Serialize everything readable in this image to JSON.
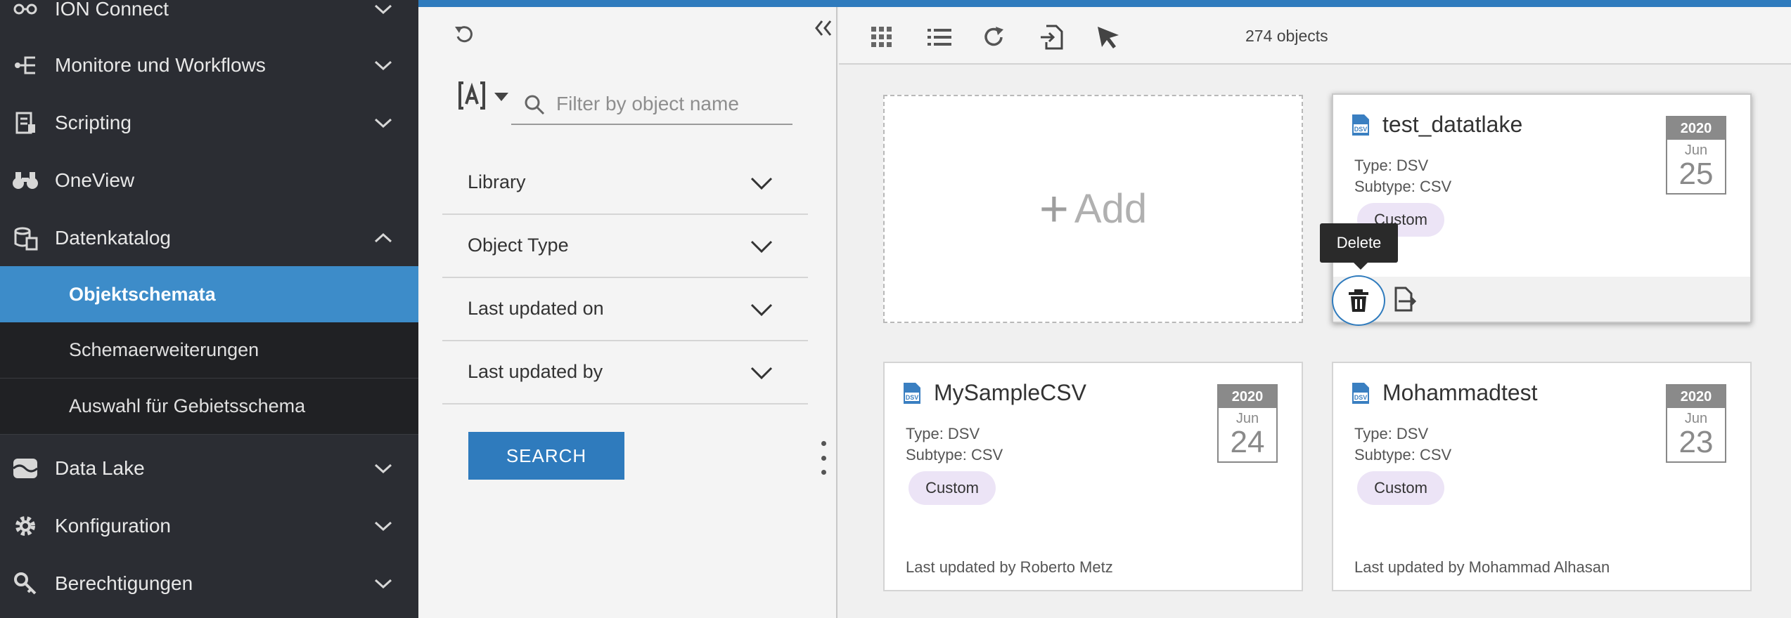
{
  "nav": {
    "items": [
      {
        "label": "ION Connect",
        "icon": "connect-icon"
      },
      {
        "label": "Monitore und Workflows",
        "icon": "workflow-icon"
      },
      {
        "label": "Scripting",
        "icon": "script-icon"
      },
      {
        "label": "OneView",
        "icon": "binoculars-icon"
      },
      {
        "label": "Datenkatalog",
        "icon": "database-icon"
      },
      {
        "label": "Data Lake",
        "icon": "lake-icon"
      },
      {
        "label": "Konfiguration",
        "icon": "gear-icon"
      },
      {
        "label": "Berechtigungen",
        "icon": "key-icon"
      }
    ],
    "subitems": [
      {
        "label": "Objektschemata",
        "active": true
      },
      {
        "label": "Schemaerweiterungen",
        "active": false
      },
      {
        "label": "Auswahl für Gebietsschema",
        "active": false
      }
    ]
  },
  "filter": {
    "search_placeholder": "Filter by object name",
    "facets": [
      "Library",
      "Object Type",
      "Last updated on",
      "Last updated by"
    ],
    "search_button": "SEARCH"
  },
  "toolbar": {
    "count_text": "274 objects"
  },
  "add_card": {
    "plus": "+",
    "label": "Add"
  },
  "cards": [
    {
      "title": "test_datatlake",
      "type": "Type: DSV",
      "subtype": "Subtype: CSV",
      "badge": "Custom",
      "date": {
        "year": "2020",
        "month": "Jun",
        "day": "25"
      }
    },
    {
      "title": "MySampleCSV",
      "type": "Type: DSV",
      "subtype": "Subtype: CSV",
      "badge": "Custom",
      "updated_by": "Last updated by Roberto Metz",
      "date": {
        "year": "2020",
        "month": "Jun",
        "day": "24"
      }
    },
    {
      "title": "Mohammadtest",
      "type": "Type: DSV",
      "subtype": "Subtype: CSV",
      "badge": "Custom",
      "updated_by": "Last updated by Mohammad Alhasan",
      "date": {
        "year": "2020",
        "month": "Jun",
        "day": "23"
      }
    }
  ],
  "tooltip": "Delete",
  "colors": {
    "accent": "#2f7bbd",
    "nav_bg": "#2b2d33",
    "nav_active": "#3d8cc9",
    "badge_bg": "#ece4f6"
  }
}
